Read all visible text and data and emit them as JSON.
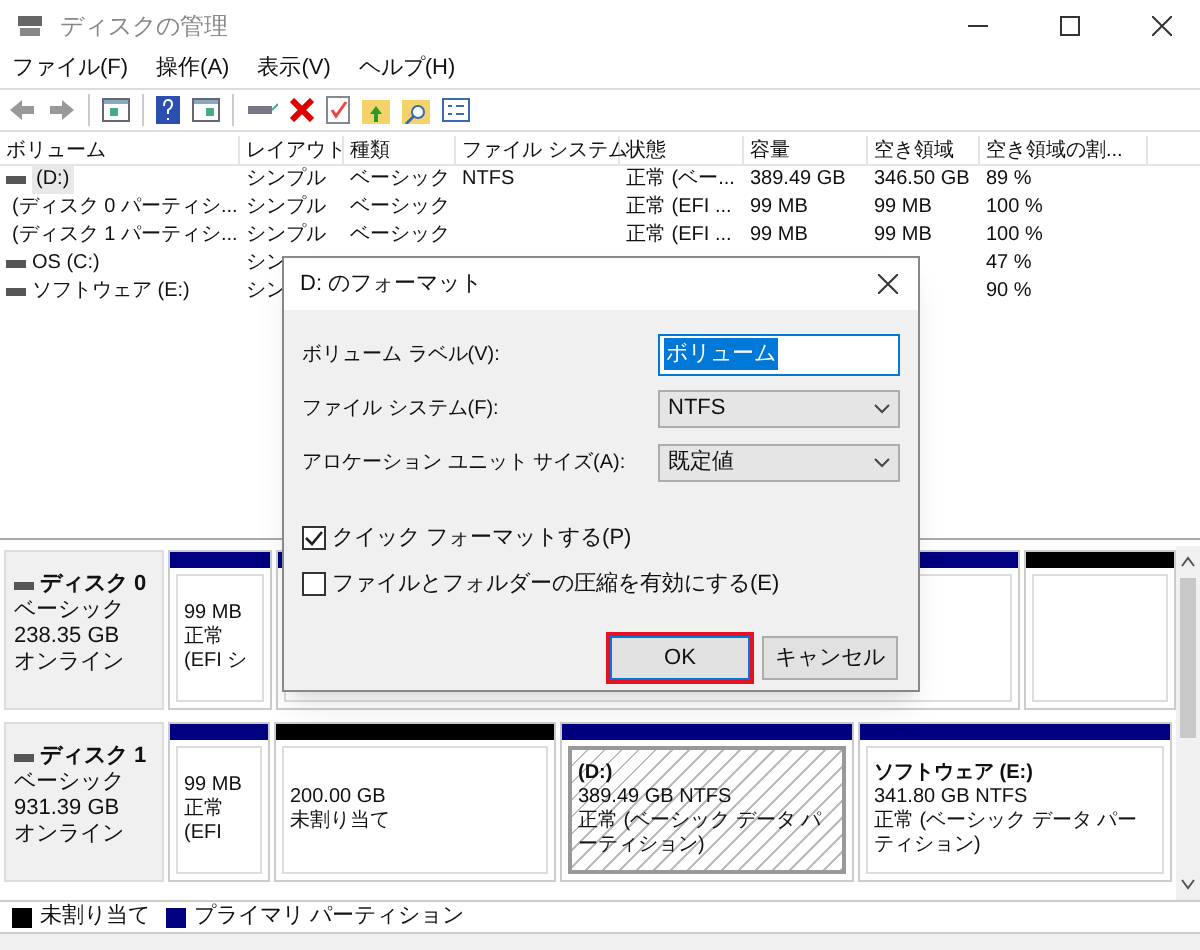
{
  "window": {
    "title": "ディスクの管理"
  },
  "menu": [
    "ファイル(F)",
    "操作(A)",
    "表示(V)",
    "ヘルプ(H)"
  ],
  "volume_table": {
    "columns": [
      "ボリューム",
      "レイアウト",
      "種類",
      "ファイル システム",
      "状態",
      "容量",
      "空き領域",
      "空き領域の割..."
    ],
    "rows": [
      {
        "selected": true,
        "cells": [
          "(D:)",
          "シンプル",
          "ベーシック",
          "NTFS",
          "正常 (ベー...",
          "389.49 GB",
          "346.50 GB",
          "89 %"
        ]
      },
      {
        "selected": false,
        "cells": [
          "(ディスク 0 パーティシ...",
          "シンプル",
          "ベーシック",
          null,
          "正常 (EFI ...",
          "99 MB",
          "99 MB",
          "100 %"
        ]
      },
      {
        "selected": false,
        "cells": [
          "(ディスク 1 パーティシ...",
          "シンプル",
          "ベーシック",
          null,
          "正常 (EFI ...",
          "99 MB",
          "99 MB",
          "100 %"
        ]
      },
      {
        "selected": false,
        "cells": [
          "OS (C:)",
          "シン",
          null,
          null,
          null,
          null,
          null,
          "47 %"
        ]
      },
      {
        "selected": false,
        "cells": [
          "ソフトウェア (E:)",
          "シン",
          null,
          null,
          null,
          null,
          null,
          "90 %"
        ]
      }
    ]
  },
  "disks": [
    {
      "name": "ディスク 0",
      "type": "ベーシック",
      "size": "238.35 GB",
      "status": "オンライン",
      "partitions": [
        {
          "kind": "primary",
          "selected": false,
          "lines": [
            "99 MB",
            "正常 (EFI シ"
          ]
        },
        {
          "kind": "primary",
          "selected": false
        },
        {
          "kind": "unallocated",
          "selected": false
        }
      ]
    },
    {
      "name": "ディスク 1",
      "type": "ベーシック",
      "size": "931.39 GB",
      "status": "オンライン",
      "partitions": [
        {
          "kind": "primary",
          "selected": false,
          "lines": [
            "99 MB",
            "正常 (EFI"
          ]
        },
        {
          "kind": "unallocated",
          "selected": false,
          "lines": [
            "200.00 GB",
            "未割り当て"
          ]
        },
        {
          "kind": "primary",
          "selected": true,
          "title": "(D:)",
          "lines": [
            "389.49 GB NTFS",
            "正常 (ベーシック データ パーティション)"
          ]
        },
        {
          "kind": "primary",
          "selected": false,
          "title": "ソフトウェア (E:)",
          "lines": [
            "341.80 GB NTFS",
            "正常 (ベーシック データ パーティション)"
          ]
        }
      ]
    }
  ],
  "legend": [
    {
      "kind": "unallocated",
      "label": "未割り当て"
    },
    {
      "kind": "primary",
      "label": "プライマリ パーティション"
    }
  ],
  "dialog": {
    "title": "D: のフォーマット",
    "fields": [
      {
        "kind": "text",
        "label": "ボリューム ラベル(V):",
        "value": "ボリューム"
      },
      {
        "kind": "select",
        "label": "ファイル システム(F):",
        "value": "NTFS"
      },
      {
        "kind": "select",
        "label": "アロケーション ユニット サイズ(A):",
        "value": "既定値"
      }
    ],
    "checkboxes": [
      {
        "label": "クイック フォーマットする(P)",
        "checked": true
      },
      {
        "label": "ファイルとフォルダーの圧縮を有効にする(E)",
        "checked": false
      }
    ],
    "buttons": [
      {
        "label": "OK",
        "default": true
      },
      {
        "label": "キャンセル",
        "default": false
      }
    ]
  }
}
